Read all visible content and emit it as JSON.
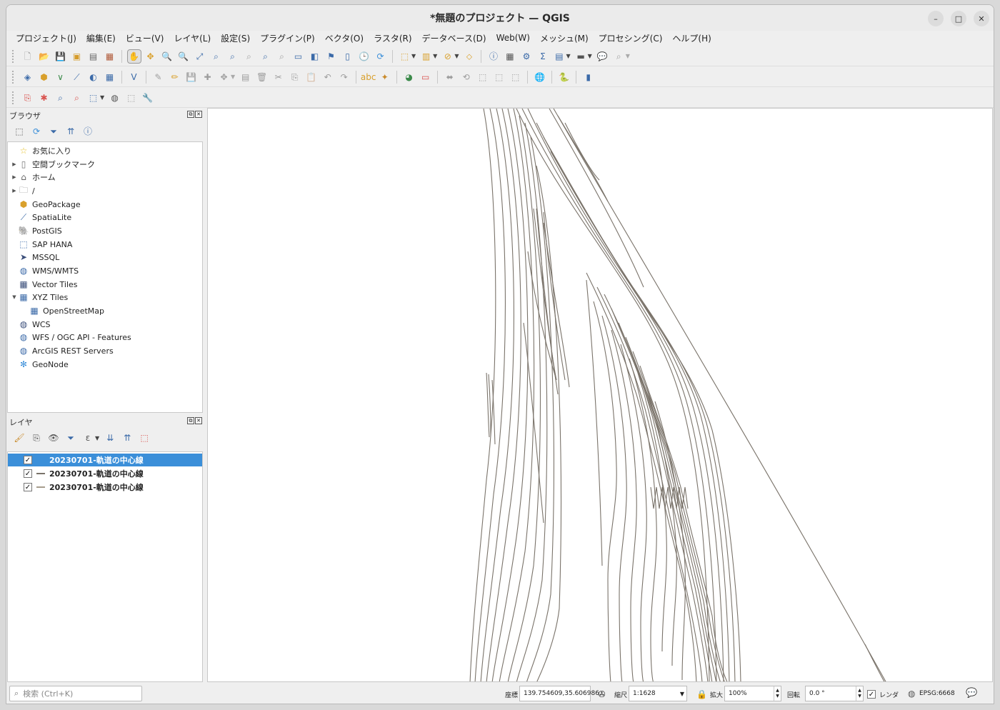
{
  "window": {
    "title": "*無題のプロジェクト — QGIS"
  },
  "menu": [
    "プロジェクト(J)",
    "編集(E)",
    "ビュー(V)",
    "レイヤ(L)",
    "設定(S)",
    "プラグイン(P)",
    "ベクタ(O)",
    "ラスタ(R)",
    "データベース(D)",
    "Web(W)",
    "メッシュ(M)",
    "プロセシング(C)",
    "ヘルプ(H)"
  ],
  "browser": {
    "title": "ブラウザ",
    "items": [
      {
        "label": "お気に入り",
        "icon": "star-icon",
        "expander": ""
      },
      {
        "label": "空間ブックマーク",
        "icon": "bookmark-icon",
        "expander": "▶"
      },
      {
        "label": "ホーム",
        "icon": "home-folder-icon",
        "expander": "▶"
      },
      {
        "label": "/",
        "icon": "folder-icon",
        "expander": "▶"
      },
      {
        "label": "GeoPackage",
        "icon": "geopackage-icon",
        "expander": ""
      },
      {
        "label": "SpatiaLite",
        "icon": "spatialite-icon",
        "expander": ""
      },
      {
        "label": "PostGIS",
        "icon": "postgis-icon",
        "expander": ""
      },
      {
        "label": "SAP HANA",
        "icon": "sap-hana-icon",
        "expander": ""
      },
      {
        "label": "MSSQL",
        "icon": "mssql-icon",
        "expander": ""
      },
      {
        "label": "WMS/WMTS",
        "icon": "wms-icon",
        "expander": ""
      },
      {
        "label": "Vector Tiles",
        "icon": "vector-tiles-icon",
        "expander": ""
      },
      {
        "label": "XYZ Tiles",
        "icon": "xyz-tiles-icon",
        "expander": "▼"
      },
      {
        "label": "OpenStreetMap",
        "icon": "xyz-tiles-icon",
        "expander": ""
      },
      {
        "label": "WCS",
        "icon": "wcs-icon",
        "expander": ""
      },
      {
        "label": "WFS / OGC API - Features",
        "icon": "wfs-icon",
        "expander": ""
      },
      {
        "label": "ArcGIS REST Servers",
        "icon": "arcgis-icon",
        "expander": ""
      },
      {
        "label": "GeoNode",
        "icon": "geonode-icon",
        "expander": ""
      }
    ]
  },
  "layers": {
    "title": "レイヤ",
    "items": [
      {
        "name": "20230701-軌道の中心線",
        "checked": "✓",
        "selected": true
      },
      {
        "name": "20230701-軌道の中心線",
        "checked": "✓",
        "selected": false
      },
      {
        "name": "20230701-軌道の中心線",
        "checked": "✓",
        "selected": false
      }
    ]
  },
  "status": {
    "search_placeholder": "検索 (Ctrl+K)",
    "coord_label": "座標",
    "coord_value": "139.754609,35.606986",
    "scale_label": "縮尺",
    "scale_value": "1:1628",
    "magnifier_label": "拡大",
    "magnifier_value": "100%",
    "rotation_label": "回転",
    "rotation_value": "0.0 °",
    "render_label": "レンダ",
    "render_checked": "✓",
    "crs": "EPSG:6668"
  },
  "colors": {
    "accent": "#3b8fd9",
    "line": "#7a736a"
  }
}
